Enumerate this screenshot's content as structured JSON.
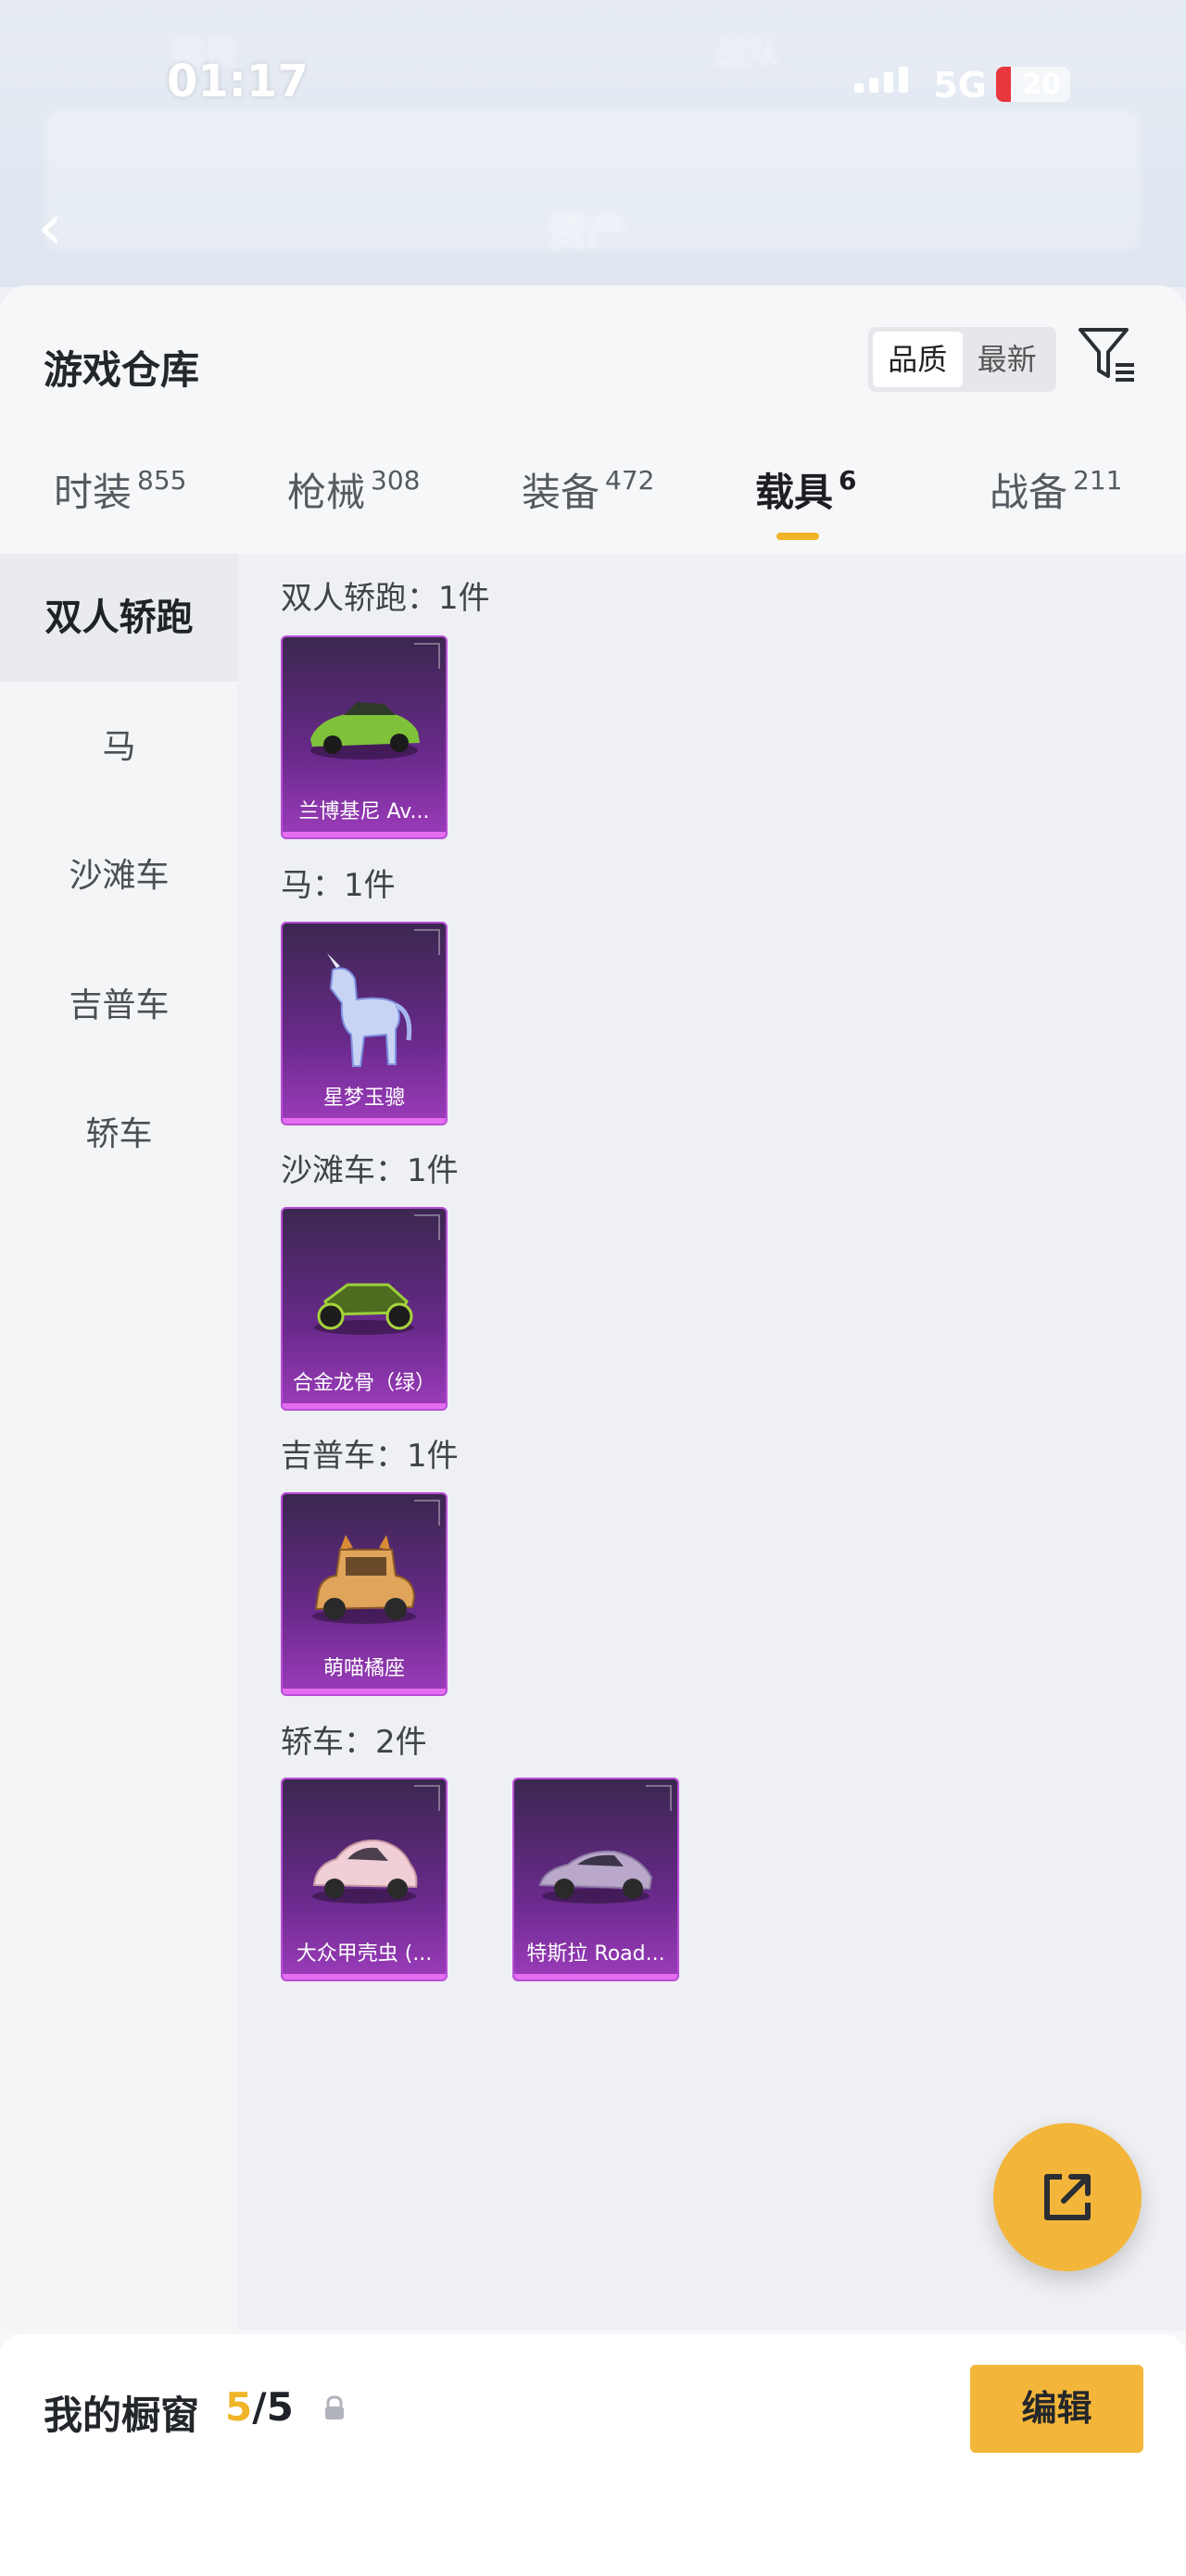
{
  "status_bar": {
    "time": "01:17",
    "network": "5G",
    "battery": "20",
    "battery_fraction": 0.2
  },
  "header_blur": {
    "title": "资产",
    "name1": "暗夜",
    "name2": "战队"
  },
  "sheet": {
    "title": "游戏仓库",
    "sort_options": [
      {
        "label": "品质",
        "active": true
      },
      {
        "label": "最新",
        "active": false
      }
    ],
    "filter_icon": "filter-icon"
  },
  "tabs": [
    {
      "label": "时装",
      "count": "855",
      "active": false
    },
    {
      "label": "枪械",
      "count": "308",
      "active": false
    },
    {
      "label": "装备",
      "count": "472",
      "active": false
    },
    {
      "label": "载具",
      "count": "6",
      "active": true
    },
    {
      "label": "战备",
      "count": "211",
      "active": false
    }
  ],
  "sidebar": [
    {
      "label": "双人轿跑",
      "active": true
    },
    {
      "label": "马",
      "active": false
    },
    {
      "label": "沙滩车",
      "active": false
    },
    {
      "label": "吉普车",
      "active": false
    },
    {
      "label": "轿车",
      "active": false
    }
  ],
  "groups": [
    {
      "label": "双人轿跑：1件",
      "items": [
        {
          "name": "兰博基尼 Av...",
          "art": "green-sports-car"
        }
      ]
    },
    {
      "label": "马：1件",
      "items": [
        {
          "name": "星梦玉骢",
          "art": "unicorn"
        }
      ]
    },
    {
      "label": "沙滩车：1件",
      "items": [
        {
          "name": "合金龙骨（绿）",
          "art": "buggy"
        }
      ]
    },
    {
      "label": "吉普车：1件",
      "items": [
        {
          "name": "萌喵橘座",
          "art": "cat-jeep"
        }
      ]
    },
    {
      "label": "轿车：2件",
      "items": [
        {
          "name": "大众甲壳虫 (...",
          "art": "beetle"
        },
        {
          "name": "特斯拉 Road...",
          "art": "tesla"
        }
      ]
    }
  ],
  "fab_icon": "share-icon",
  "bottom": {
    "label": "我的橱窗",
    "current": "5",
    "total": "/5",
    "lock_icon": "lock-icon",
    "edit_label": "编辑"
  },
  "colors": {
    "accent": "#f0b429",
    "card_top": "#3b2750",
    "card_bottom": "#9c3cbb"
  }
}
